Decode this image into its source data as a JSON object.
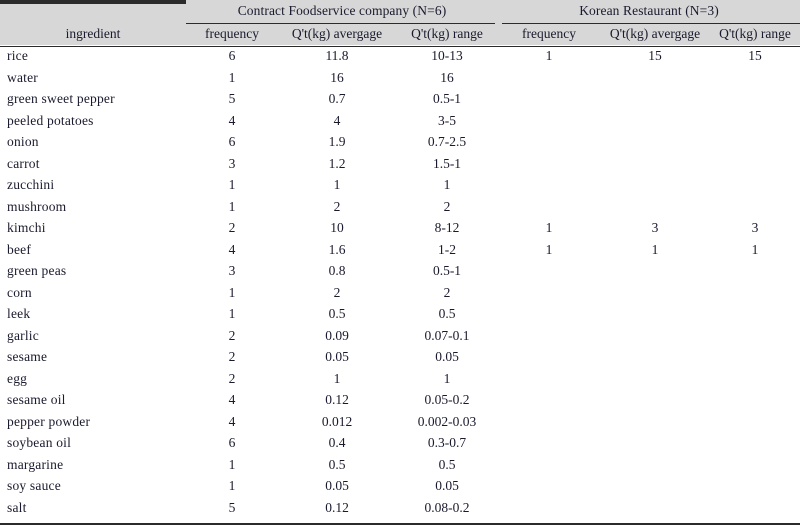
{
  "table": {
    "groups": [
      {
        "label": "Contract Foodservice company (N=6)",
        "n": 6
      },
      {
        "label": "Korean Restaurant (N=3)",
        "n": 3
      }
    ],
    "columns": [
      "ingredient",
      "frequency",
      "Q't(kg) avergage",
      "Q't(kg) range",
      "frequency",
      "Q't(kg) avergage",
      "Q't(kg) range"
    ],
    "rows": [
      {
        "ingredient": "rice",
        "a_freq": "6",
        "a_avg": "11.8",
        "a_range": "10-13",
        "b_freq": "1",
        "b_avg": "15",
        "b_range": "15"
      },
      {
        "ingredient": "water",
        "a_freq": "1",
        "a_avg": "16",
        "a_range": "16",
        "b_freq": "",
        "b_avg": "",
        "b_range": ""
      },
      {
        "ingredient": "green sweet pepper",
        "a_freq": "5",
        "a_avg": "0.7",
        "a_range": "0.5-1",
        "b_freq": "",
        "b_avg": "",
        "b_range": ""
      },
      {
        "ingredient": "peeled potatoes",
        "a_freq": "4",
        "a_avg": "4",
        "a_range": "3-5",
        "b_freq": "",
        "b_avg": "",
        "b_range": ""
      },
      {
        "ingredient": "onion",
        "a_freq": "6",
        "a_avg": "1.9",
        "a_range": "0.7-2.5",
        "b_freq": "",
        "b_avg": "",
        "b_range": ""
      },
      {
        "ingredient": "carrot",
        "a_freq": "3",
        "a_avg": "1.2",
        "a_range": "1.5-1",
        "b_freq": "",
        "b_avg": "",
        "b_range": ""
      },
      {
        "ingredient": "zucchini",
        "a_freq": "1",
        "a_avg": "1",
        "a_range": "1",
        "b_freq": "",
        "b_avg": "",
        "b_range": ""
      },
      {
        "ingredient": "mushroom",
        "a_freq": "1",
        "a_avg": "2",
        "a_range": "2",
        "b_freq": "",
        "b_avg": "",
        "b_range": ""
      },
      {
        "ingredient": "kimchi",
        "a_freq": "2",
        "a_avg": "10",
        "a_range": "8-12",
        "b_freq": "1",
        "b_avg": "3",
        "b_range": "3"
      },
      {
        "ingredient": "beef",
        "a_freq": "4",
        "a_avg": "1.6",
        "a_range": "1-2",
        "b_freq": "1",
        "b_avg": "1",
        "b_range": "1"
      },
      {
        "ingredient": "green peas",
        "a_freq": "3",
        "a_avg": "0.8",
        "a_range": "0.5-1",
        "b_freq": "",
        "b_avg": "",
        "b_range": ""
      },
      {
        "ingredient": "corn",
        "a_freq": "1",
        "a_avg": "2",
        "a_range": "2",
        "b_freq": "",
        "b_avg": "",
        "b_range": ""
      },
      {
        "ingredient": "leek",
        "a_freq": "1",
        "a_avg": "0.5",
        "a_range": "0.5",
        "b_freq": "",
        "b_avg": "",
        "b_range": ""
      },
      {
        "ingredient": "garlic",
        "a_freq": "2",
        "a_avg": "0.09",
        "a_range": "0.07-0.1",
        "b_freq": "",
        "b_avg": "",
        "b_range": ""
      },
      {
        "ingredient": "sesame",
        "a_freq": "2",
        "a_avg": "0.05",
        "a_range": "0.05",
        "b_freq": "",
        "b_avg": "",
        "b_range": ""
      },
      {
        "ingredient": "egg",
        "a_freq": "2",
        "a_avg": "1",
        "a_range": "1",
        "b_freq": "",
        "b_avg": "",
        "b_range": ""
      },
      {
        "ingredient": "sesame oil",
        "a_freq": "4",
        "a_avg": "0.12",
        "a_range": "0.05-0.2",
        "b_freq": "",
        "b_avg": "",
        "b_range": ""
      },
      {
        "ingredient": "pepper powder",
        "a_freq": "4",
        "a_avg": "0.012",
        "a_range": "0.002-0.03",
        "b_freq": "",
        "b_avg": "",
        "b_range": ""
      },
      {
        "ingredient": "soybean oil",
        "a_freq": "6",
        "a_avg": "0.4",
        "a_range": "0.3-0.7",
        "b_freq": "",
        "b_avg": "",
        "b_range": ""
      },
      {
        "ingredient": "margarine",
        "a_freq": "1",
        "a_avg": "0.5",
        "a_range": "0.5",
        "b_freq": "",
        "b_avg": "",
        "b_range": ""
      },
      {
        "ingredient": "soy sauce",
        "a_freq": "1",
        "a_avg": "0.05",
        "a_range": "0.05",
        "b_freq": "",
        "b_avg": "",
        "b_range": ""
      },
      {
        "ingredient": "salt",
        "a_freq": "5",
        "a_avg": "0.12",
        "a_range": "0.08-0.2",
        "b_freq": "",
        "b_avg": "",
        "b_range": ""
      }
    ]
  },
  "colors": {
    "header_background": "#d7d7d7",
    "rule": "#2b2b2b",
    "text": "#1a1a2e",
    "body_background": "#ffffff"
  }
}
